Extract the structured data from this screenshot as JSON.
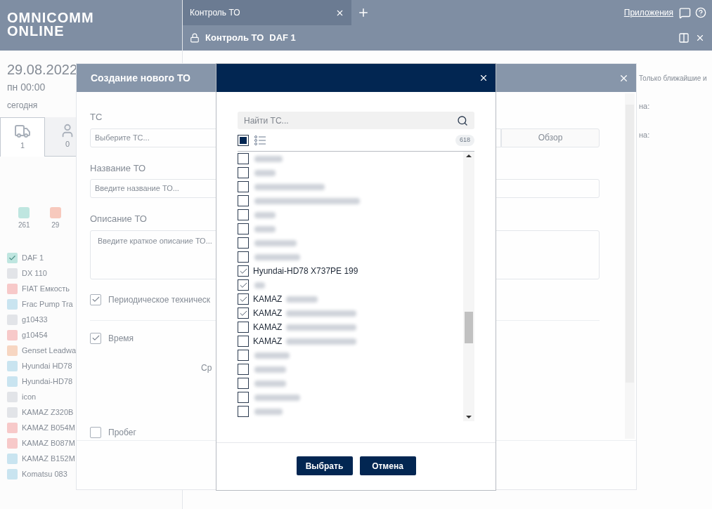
{
  "app_header": {
    "logo": [
      "OMNICOMM",
      "ONLINE"
    ],
    "tabs": [
      {
        "label": "Контроль ТО",
        "selected": true
      }
    ],
    "apps_link": "Приложения"
  },
  "breadcrumb": {
    "title": "Контроль ТО",
    "vehicle": "DAF 1"
  },
  "sidebar": {
    "date": "29.08.2022",
    "weekday_time": "пн 00:00",
    "today": "сегодня",
    "object_tabs": [
      {
        "kind": "vehicle",
        "count": "1",
        "selected": true
      },
      {
        "kind": "driver",
        "count": "0",
        "selected": false
      }
    ],
    "status_counts": [
      {
        "count": "261",
        "color": "#bfe6e0"
      },
      {
        "count": "29",
        "color": "#f7c9bd"
      }
    ],
    "vehicles": [
      {
        "name": "DAF 1",
        "color": "#bfe6e0",
        "checked": true
      },
      {
        "name": "DX 110",
        "color": "#e2e4e8",
        "checked": false
      },
      {
        "name": "FIAT Емкость",
        "color": "#f7c9c9",
        "checked": false
      },
      {
        "name": "Frac Pump Tra",
        "color": "#c9e4f0",
        "checked": false
      },
      {
        "name": "g10433",
        "color": "#e2e4e8",
        "checked": false
      },
      {
        "name": "g10454",
        "color": "#f7c9c9",
        "checked": false
      },
      {
        "name": "Genset Leadwa",
        "color": "#f7d6c2",
        "checked": false
      },
      {
        "name": "Hyundai HD78",
        "color": "#c9e4f0",
        "checked": false
      },
      {
        "name": "Hyundai-HD78",
        "color": "#c9e4f0",
        "checked": false
      },
      {
        "name": "icon",
        "color": "#e2e4e8",
        "checked": false
      },
      {
        "name": "KAMAZ Z320B",
        "color": "#e2e4e8",
        "checked": false
      },
      {
        "name": "KAMAZ B054M",
        "color": "#f7c9c9",
        "checked": false
      },
      {
        "name": "KAMAZ B087M",
        "color": "#f7c9c9",
        "checked": false
      },
      {
        "name": "KAMAZ B152M",
        "color": "#c9e4f0",
        "checked": false
      },
      {
        "name": "Komatsu 083",
        "color": "#c9e4f0",
        "checked": false
      }
    ]
  },
  "right_panel": {
    "filter_label": "Только ближайшие и",
    "rows": [
      "на:",
      "на:"
    ]
  },
  "create_dialog": {
    "title": "Создание нового ТО",
    "vehicle_label": "ТС",
    "vehicle_placeholder": "Выберите ТС...",
    "browse_button": "Обзор",
    "name_label": "Название ТО",
    "name_placeholder": "Введите название ТО...",
    "description_label": "Описание ТО",
    "description_placeholder": "Введите краткое описание ТО...",
    "options": [
      {
        "label": "Периодическое техническ",
        "checked": true
      },
      {
        "label": "Время",
        "checked": true
      }
    ],
    "partial_text": "Ср",
    "mileage": {
      "label": "Пробег",
      "checked": false
    }
  },
  "select_dialog": {
    "search_placeholder": "Найти ТС...",
    "select_all": {
      "indeterminate": true
    },
    "total": "618",
    "items": [
      {
        "kind": "redacted",
        "checked": false
      },
      {
        "kind": "redacted",
        "checked": false
      },
      {
        "kind": "redacted",
        "checked": false
      },
      {
        "kind": "redacted",
        "checked": false
      },
      {
        "kind": "redacted",
        "checked": false
      },
      {
        "kind": "redacted",
        "checked": false
      },
      {
        "kind": "redacted",
        "checked": false
      },
      {
        "kind": "redacted",
        "checked": false
      },
      {
        "kind": "text",
        "label": "Hyundai-HD78 X737PE 199",
        "checked": true
      },
      {
        "kind": "redacted",
        "checked": true
      },
      {
        "kind": "partial",
        "label": "KAMAZ",
        "checked": true
      },
      {
        "kind": "partial",
        "label": "KAMAZ",
        "checked": true
      },
      {
        "kind": "partial",
        "label": "KAMAZ",
        "checked": false
      },
      {
        "kind": "partial",
        "label": "KAMAZ",
        "checked": false
      },
      {
        "kind": "redacted",
        "checked": false
      },
      {
        "kind": "redacted",
        "checked": false
      },
      {
        "kind": "redacted",
        "checked": false
      },
      {
        "kind": "redacted",
        "checked": false
      },
      {
        "kind": "redacted",
        "checked": false
      }
    ],
    "buttons": [
      "Выбрать",
      "Отмена"
    ]
  }
}
